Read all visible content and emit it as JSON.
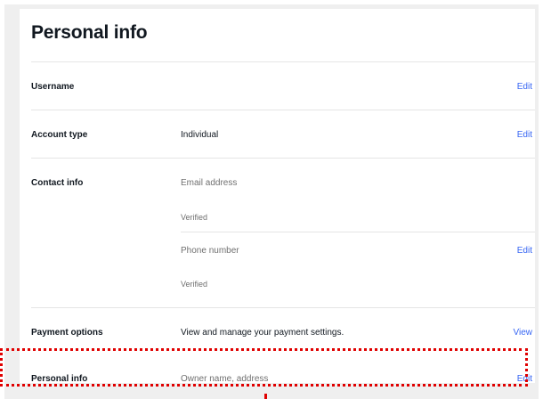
{
  "page": {
    "title": "Personal info"
  },
  "rows": {
    "username": {
      "label": "Username",
      "action": "Edit"
    },
    "account_type": {
      "label": "Account type",
      "value": "Individual",
      "action": "Edit"
    },
    "contact_info": {
      "label": "Contact info",
      "email_label": "Email address",
      "email_status": "Verified",
      "phone_label": "Phone number",
      "phone_status": "Verified",
      "phone_action": "Edit"
    },
    "payment_options": {
      "label": "Payment options",
      "value": "View and manage your payment settings.",
      "action": "View"
    },
    "personal_info": {
      "label": "Personal info",
      "value": "Owner name, address",
      "action": "Edit"
    }
  },
  "colors": {
    "link": "#3665f3",
    "highlight": "#e00000",
    "background": "#efefef"
  }
}
